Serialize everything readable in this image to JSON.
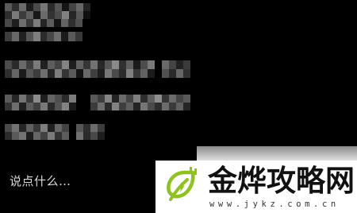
{
  "comment_input": {
    "placeholder": "说点什么…"
  },
  "watermark": {
    "title": "金烨攻略网",
    "url": "www.jykz.com.cn",
    "logo_icon": "leaf-plug-logo-icon",
    "logo_color": "#8dc21f"
  }
}
